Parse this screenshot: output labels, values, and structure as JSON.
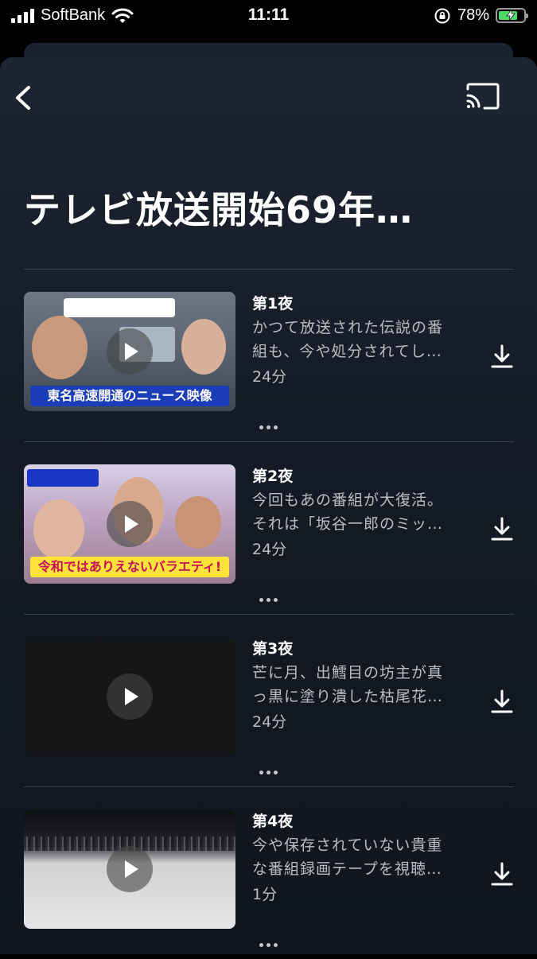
{
  "status_bar": {
    "carrier": "SoftBank",
    "time": "11:11",
    "battery_percent": "78%",
    "battery_level": 0.78,
    "charging": true
  },
  "header": {
    "back_icon": "chevron-left-icon",
    "cast_icon": "cast-icon"
  },
  "page_title": "テレビ放送開始69年…",
  "episodes": [
    {
      "title": "第1夜",
      "desc_line1": "かつて放送された伝説の番",
      "desc_line2": "組も、今や処分されてし…",
      "duration": "24分",
      "thumb_text": "東名高速開通のニュース映像"
    },
    {
      "title": "第2夜",
      "desc_line1": "今回もあの番組が大復活。",
      "desc_line2": "それは「坂谷一郎のミッ…",
      "duration": "24分",
      "thumb_text": "令和ではありえないバラエティ!"
    },
    {
      "title": "第3夜",
      "desc_line1": "芒に月、出鱈目の坊主が真",
      "desc_line2": "っ黒に塗り潰した枯尾花…",
      "duration": "24分"
    },
    {
      "title": "第4夜",
      "desc_line1": "今や保存されていない貴重",
      "desc_line2": "な番組録画テープを視聴…",
      "duration": "1分"
    }
  ],
  "colors": {
    "background": "#000000",
    "sheet": "#1a212d",
    "text_primary": "#ffffff",
    "text_secondary": "#b9bec6",
    "divider": "#3a4250",
    "battery_fill": "#4cd964"
  }
}
